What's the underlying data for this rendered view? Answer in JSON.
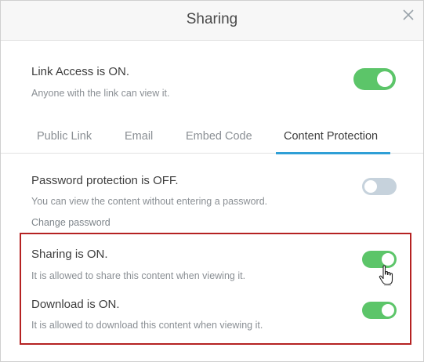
{
  "dialog": {
    "title": "Sharing",
    "close_icon": "close-icon"
  },
  "link_access": {
    "title": "Link Access is ON.",
    "subtitle": "Anyone with the link can view it.",
    "enabled": true
  },
  "tabs": [
    {
      "label": "Public Link",
      "active": false
    },
    {
      "label": "Email",
      "active": false
    },
    {
      "label": "Embed Code",
      "active": false
    },
    {
      "label": "Content Protection",
      "active": true
    }
  ],
  "password": {
    "title": "Password protection is OFF.",
    "subtitle": "You can view the content without entering a password.",
    "link": "Change password",
    "enabled": false
  },
  "sharing": {
    "title": "Sharing is ON.",
    "subtitle": "It is allowed to share this content when viewing it.",
    "enabled": true
  },
  "download": {
    "title": "Download is ON.",
    "subtitle": "It is allowed to download this content when viewing it.",
    "enabled": true
  },
  "colors": {
    "toggle_on": "#5cc569",
    "toggle_off": "#c6d2dc",
    "tab_accent": "#2f9fd6",
    "highlight_border": "#b52222"
  },
  "cursor_icon": "hand-pointer-icon"
}
